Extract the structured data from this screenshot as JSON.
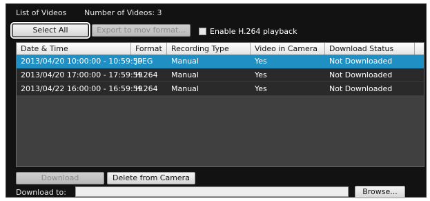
{
  "header": {
    "title": "List of Videos",
    "count_label": "Number of Videos: 3"
  },
  "toolbar": {
    "select_all": "Select All",
    "export": "Export to mov format...",
    "h264_label": "Enable H.264 playback",
    "h264_checked": false
  },
  "table": {
    "columns": [
      "Date & Time",
      "Format",
      "Recording Type",
      "Video in Camera",
      "Download Status"
    ],
    "rows": [
      {
        "datetime": "2013/04/20 10:00:00 - 10:59:59",
        "format": "JPEG",
        "type": "Manual",
        "in_camera": "Yes",
        "status": "Not Downloaded",
        "selected": true
      },
      {
        "datetime": "2013/04/20 17:00:00 - 17:59:59",
        "format": "H.264",
        "type": "Manual",
        "in_camera": "Yes",
        "status": "Not Downloaded",
        "selected": false
      },
      {
        "datetime": "2013/04/22 16:00:00 - 16:59:59",
        "format": "H.264",
        "type": "Manual",
        "in_camera": "Yes",
        "status": "Not Downloaded",
        "selected": false
      }
    ]
  },
  "actions": {
    "download": "Download",
    "delete": "Delete from Camera"
  },
  "download_to": {
    "label": "Download to:",
    "value": "",
    "browse": "Browse..."
  },
  "colors": {
    "selection": "#1f8fc4",
    "panel_bg": "#121212"
  }
}
